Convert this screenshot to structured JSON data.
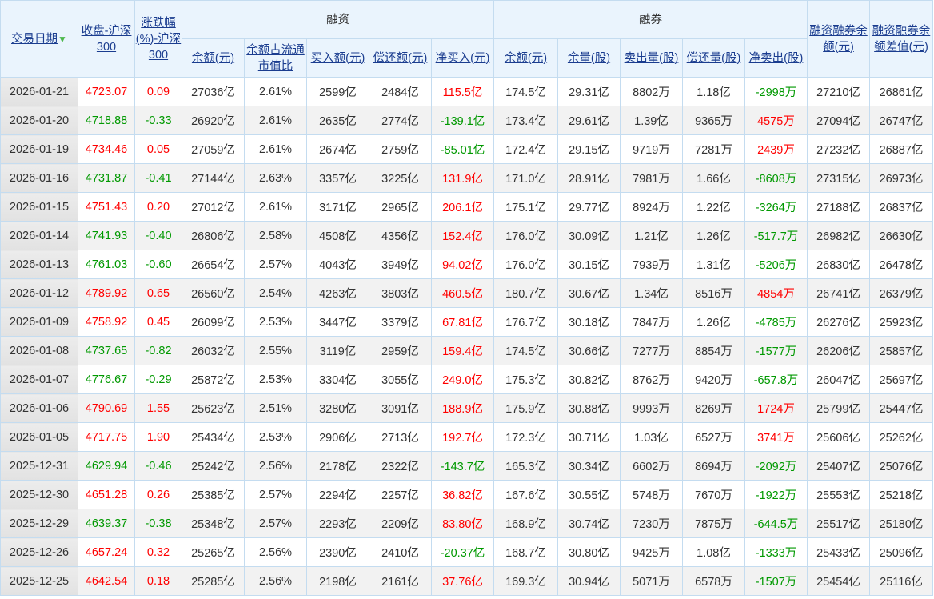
{
  "header": {
    "date": "交易日期",
    "close": "收盘-沪深300",
    "change": "涨跌幅(%)-沪深300",
    "financing": "融资",
    "lending": "融券",
    "fin_cols": [
      "余额(元)",
      "余额占流通市值比",
      "买入额(元)",
      "偿还额(元)",
      "净买入(元)"
    ],
    "lend_cols": [
      "余额(元)",
      "余量(股)",
      "卖出量(股)",
      "偿还量(股)",
      "净卖出(股)"
    ],
    "total": "融资融券余额(元)",
    "diff": "融资融券余额差值(元)",
    "sort_icon": "arrow-down-icon"
  },
  "colors": {
    "up": "#ff0000",
    "down": "#009900",
    "link": "#1a3c8f",
    "header_bg": "#eaf4fd"
  },
  "rows": [
    [
      "2026-01-21",
      "4723.07",
      "0.09",
      "27036亿",
      "2.61%",
      "2599亿",
      "2484亿",
      "115.5亿",
      "174.5亿",
      "29.31亿",
      "8802万",
      "1.18亿",
      "-2998万",
      "27210亿",
      "26861亿"
    ],
    [
      "2026-01-20",
      "4718.88",
      "-0.33",
      "26920亿",
      "2.61%",
      "2635亿",
      "2774亿",
      "-139.1亿",
      "173.4亿",
      "29.61亿",
      "1.39亿",
      "9365万",
      "4575万",
      "27094亿",
      "26747亿"
    ],
    [
      "2026-01-19",
      "4734.46",
      "0.05",
      "27059亿",
      "2.61%",
      "2674亿",
      "2759亿",
      "-85.01亿",
      "172.4亿",
      "29.15亿",
      "9719万",
      "7281万",
      "2439万",
      "27232亿",
      "26887亿"
    ],
    [
      "2026-01-16",
      "4731.87",
      "-0.41",
      "27144亿",
      "2.63%",
      "3357亿",
      "3225亿",
      "131.9亿",
      "171.0亿",
      "28.91亿",
      "7981万",
      "1.66亿",
      "-8608万",
      "27315亿",
      "26973亿"
    ],
    [
      "2026-01-15",
      "4751.43",
      "0.20",
      "27012亿",
      "2.61%",
      "3171亿",
      "2965亿",
      "206.1亿",
      "175.1亿",
      "29.77亿",
      "8924万",
      "1.22亿",
      "-3264万",
      "27188亿",
      "26837亿"
    ],
    [
      "2026-01-14",
      "4741.93",
      "-0.40",
      "26806亿",
      "2.58%",
      "4508亿",
      "4356亿",
      "152.4亿",
      "176.0亿",
      "30.09亿",
      "1.21亿",
      "1.26亿",
      "-517.7万",
      "26982亿",
      "26630亿"
    ],
    [
      "2026-01-13",
      "4761.03",
      "-0.60",
      "26654亿",
      "2.57%",
      "4043亿",
      "3949亿",
      "94.02亿",
      "176.0亿",
      "30.15亿",
      "7939万",
      "1.31亿",
      "-5206万",
      "26830亿",
      "26478亿"
    ],
    [
      "2026-01-12",
      "4789.92",
      "0.65",
      "26560亿",
      "2.54%",
      "4263亿",
      "3803亿",
      "460.5亿",
      "180.7亿",
      "30.67亿",
      "1.34亿",
      "8516万",
      "4854万",
      "26741亿",
      "26379亿"
    ],
    [
      "2026-01-09",
      "4758.92",
      "0.45",
      "26099亿",
      "2.53%",
      "3447亿",
      "3379亿",
      "67.81亿",
      "176.7亿",
      "30.18亿",
      "7847万",
      "1.26亿",
      "-4785万",
      "26276亿",
      "25923亿"
    ],
    [
      "2026-01-08",
      "4737.65",
      "-0.82",
      "26032亿",
      "2.55%",
      "3119亿",
      "2959亿",
      "159.4亿",
      "174.5亿",
      "30.66亿",
      "7277万",
      "8854万",
      "-1577万",
      "26206亿",
      "25857亿"
    ],
    [
      "2026-01-07",
      "4776.67",
      "-0.29",
      "25872亿",
      "2.53%",
      "3304亿",
      "3055亿",
      "249.0亿",
      "175.3亿",
      "30.82亿",
      "8762万",
      "9420万",
      "-657.8万",
      "26047亿",
      "25697亿"
    ],
    [
      "2026-01-06",
      "4790.69",
      "1.55",
      "25623亿",
      "2.51%",
      "3280亿",
      "3091亿",
      "188.9亿",
      "175.9亿",
      "30.88亿",
      "9993万",
      "8269万",
      "1724万",
      "25799亿",
      "25447亿"
    ],
    [
      "2026-01-05",
      "4717.75",
      "1.90",
      "25434亿",
      "2.53%",
      "2906亿",
      "2713亿",
      "192.7亿",
      "172.3亿",
      "30.71亿",
      "1.03亿",
      "6527万",
      "3741万",
      "25606亿",
      "25262亿"
    ],
    [
      "2025-12-31",
      "4629.94",
      "-0.46",
      "25242亿",
      "2.56%",
      "2178亿",
      "2322亿",
      "-143.7亿",
      "165.3亿",
      "30.34亿",
      "6602万",
      "8694万",
      "-2092万",
      "25407亿",
      "25076亿"
    ],
    [
      "2025-12-30",
      "4651.28",
      "0.26",
      "25385亿",
      "2.57%",
      "2294亿",
      "2257亿",
      "36.82亿",
      "167.6亿",
      "30.55亿",
      "5748万",
      "7670万",
      "-1922万",
      "25553亿",
      "25218亿"
    ],
    [
      "2025-12-29",
      "4639.37",
      "-0.38",
      "25348亿",
      "2.57%",
      "2293亿",
      "2209亿",
      "83.80亿",
      "168.9亿",
      "30.74亿",
      "7230万",
      "7875万",
      "-644.5万",
      "25517亿",
      "25180亿"
    ],
    [
      "2025-12-26",
      "4657.24",
      "0.32",
      "25265亿",
      "2.56%",
      "2390亿",
      "2410亿",
      "-20.37亿",
      "168.7亿",
      "30.80亿",
      "9425万",
      "1.08亿",
      "-1333万",
      "25433亿",
      "25096亿"
    ],
    [
      "2025-12-25",
      "4642.54",
      "0.18",
      "25285亿",
      "2.56%",
      "2198亿",
      "2161亿",
      "37.76亿",
      "169.3亿",
      "30.94亿",
      "5071万",
      "6578万",
      "-1507万",
      "25454亿",
      "25116亿"
    ]
  ]
}
